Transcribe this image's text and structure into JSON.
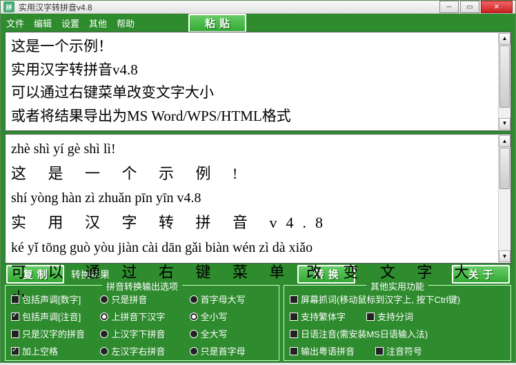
{
  "title": "实用汉字转拼音v4.8",
  "menu": {
    "file": "文件",
    "edit": "编辑",
    "settings": "设置",
    "other": "其他",
    "help": "帮助"
  },
  "btn": {
    "paste": "粘贴",
    "copy": "复制",
    "convert": "转换",
    "about": "关于"
  },
  "resultLabel": "转换结果",
  "input": {
    "l1": "这是一个示例！",
    "l2": "实用汉字转拼音v4.8",
    "l3": "可以通过右键菜单改变文字大小",
    "l4": "或者将结果导出为MS Word/WPS/HTML格式"
  },
  "output": {
    "p1": "zhè shì yí gè shì lì!",
    "h1": "这 是 一 个 示 例 !",
    "p2": "shí yòng hàn zì zhuǎn pīn yīn v4.8",
    "h2": "实 用 汉 字 转   拼 音   v4.8",
    "p3": "ké yǐ tōng guò yòu jiàn cài dān gǎi biàn wén zì dà xiǎo",
    "h3": "可 以 通 过 右 键 菜 单 改 变 文 字 大 小"
  },
  "panel1": {
    "legend": "拼音转换输出选项",
    "c1": {
      "a": "包括声调[数字]",
      "b": "包括声调[注音]",
      "c": "只是汉字的拼音",
      "d": "加上空格"
    },
    "c2": {
      "a": "只是拼音",
      "b": "上拼音下汉字",
      "c": "上汉字下拼音",
      "d": "左汉字右拼音"
    },
    "c3": {
      "a": "首字母大写",
      "b": "全小写",
      "c": "全大写",
      "d": "只是首字母"
    }
  },
  "panel2": {
    "legend": "其他实用功能",
    "a": "屏幕抓词(移动鼠标到汉字上, 按下Ctrl键)",
    "b": "支持繁体字",
    "c": "支持分词",
    "d": "日语注音(需安装MS日语输入法)",
    "e": "输出粤语拼音",
    "f": "注音符号"
  }
}
